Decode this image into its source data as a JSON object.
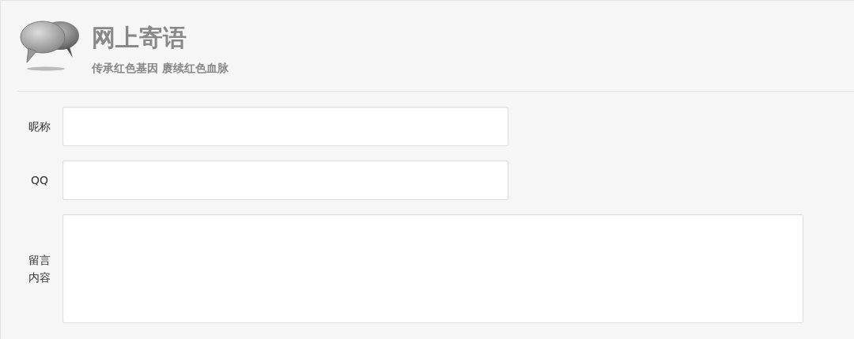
{
  "header": {
    "title": "网上寄语",
    "subtitle": "传承红色基因 赓续红色血脉"
  },
  "form": {
    "fields": [
      {
        "kind": "input",
        "label": "昵称"
      },
      {
        "kind": "input",
        "label": "QQ"
      },
      {
        "kind": "textarea",
        "label": "留言内容"
      }
    ]
  }
}
